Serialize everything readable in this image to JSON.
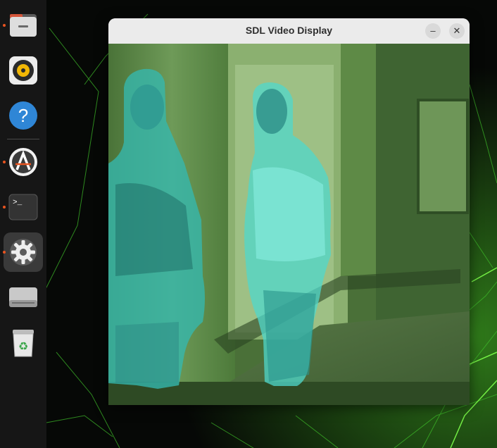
{
  "window": {
    "title": "SDL Video Display",
    "minimize_glyph": "–",
    "close_glyph": "✕"
  },
  "dock": {
    "items": [
      {
        "icon": "files-icon",
        "running": true
      },
      {
        "icon": "rhythmbox-icon",
        "running": false
      },
      {
        "icon": "help-icon",
        "running": false
      },
      {
        "icon": "software-updater-icon",
        "running": true
      },
      {
        "icon": "terminal-icon",
        "running": true
      },
      {
        "icon": "settings-icon",
        "running": true,
        "active": true
      },
      {
        "icon": "disk-drive-icon",
        "running": false
      },
      {
        "icon": "trash-icon",
        "running": false
      }
    ],
    "help_glyph": "?",
    "terminal_glyph": ">_",
    "trash_glyph": "♻"
  },
  "colors": {
    "dock_bg": "#161616",
    "running_indicator": "#e95420",
    "segmentation_overlay": "#35b8b0"
  }
}
